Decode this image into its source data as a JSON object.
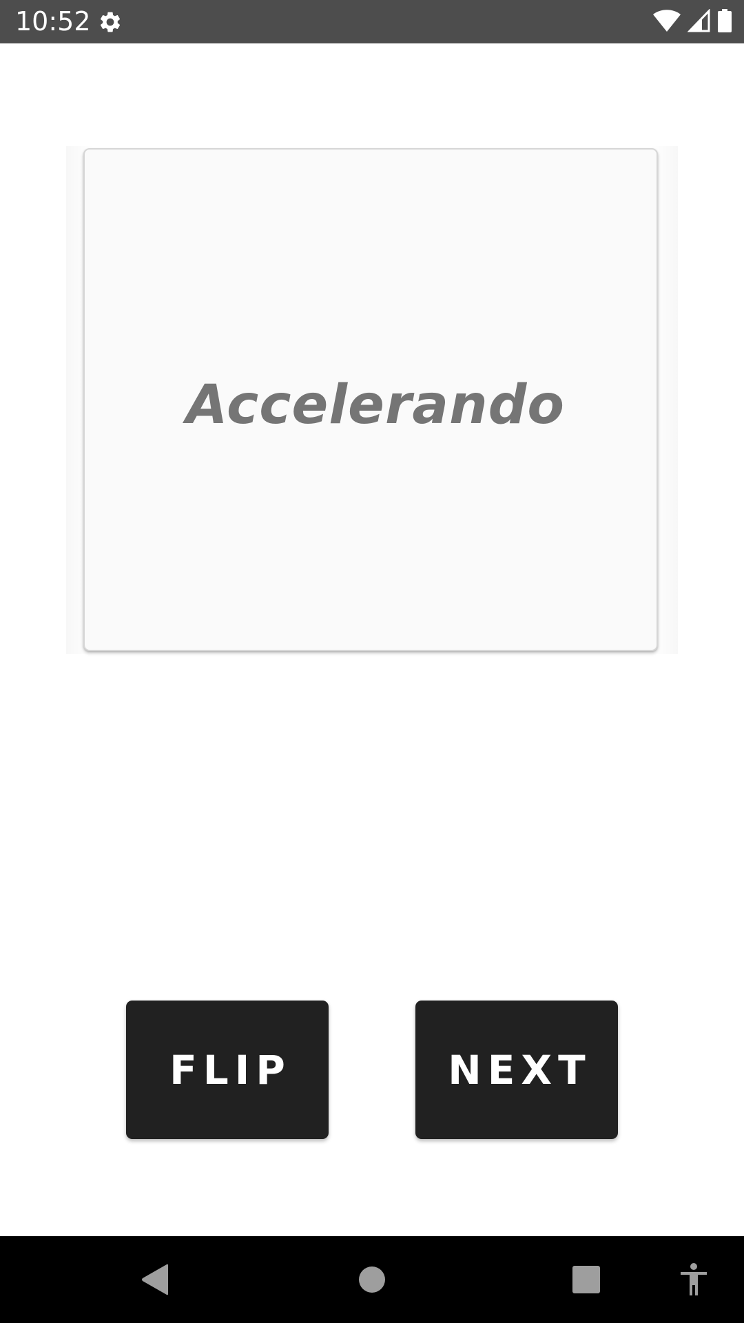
{
  "status_bar": {
    "time": "10:52",
    "icons": [
      "gear-icon",
      "wifi-icon",
      "signal-icon",
      "battery-icon"
    ],
    "background": "#4d4d4d"
  },
  "card": {
    "text": "Accelerando",
    "text_color": "#757575",
    "background": "#fafafa"
  },
  "buttons": {
    "flip_label": "FLIP",
    "next_label": "NEXT",
    "background": "#212121"
  },
  "nav_bar": {
    "icons": [
      "back-icon",
      "home-icon",
      "recents-icon",
      "accessibility-icon"
    ]
  }
}
